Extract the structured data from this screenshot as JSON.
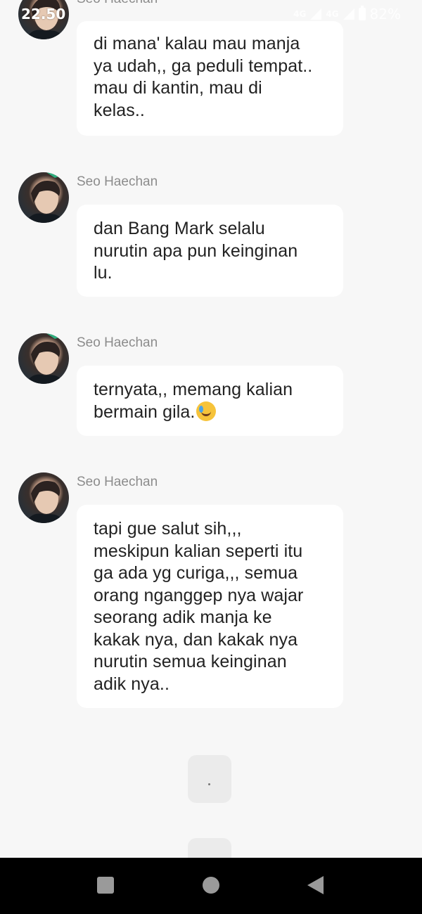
{
  "status_bar": {
    "time": "22.50",
    "network_1": "4G",
    "network_2": "4G",
    "battery": "82%"
  },
  "messages": [
    {
      "sender": "Seo Haechan",
      "lines": [
        "di mana' kalau mau manja",
        "ya udah,, ga peduli tempat..",
        "mau di kantin, mau di",
        "kelas.."
      ]
    },
    {
      "sender": "Seo Haechan",
      "lines": [
        "dan Bang Mark selalu",
        "nurutin apa pun keinginan",
        "lu."
      ]
    },
    {
      "sender": "Seo Haechan",
      "lines": [
        "ternyata,, memang kalian",
        "bermain gila."
      ],
      "emoji": "rolling-on-floor-laughing-emoji"
    },
    {
      "sender": "Seo Haechan",
      "lines": [
        "tapi gue salut sih,,,",
        "meskipun kalian seperti itu",
        "ga ada yg curiga,,, semua",
        "orang nganggep nya wajar",
        "seorang adik manja ke",
        "kakak nya, dan kakak nya",
        "nurutin semua keinginan",
        "adik nya.."
      ]
    }
  ],
  "typing_indicator": {
    "text": "."
  },
  "nav_bar": {
    "recents_icon": "square-icon",
    "home_icon": "circle-icon",
    "back_icon": "triangle-back-icon"
  },
  "colors": {
    "background": "#f7f7f7",
    "bubble": "#ffffff",
    "sender_text": "#8c8c8c",
    "message_text": "#222222",
    "nav_bar": "#000000"
  }
}
